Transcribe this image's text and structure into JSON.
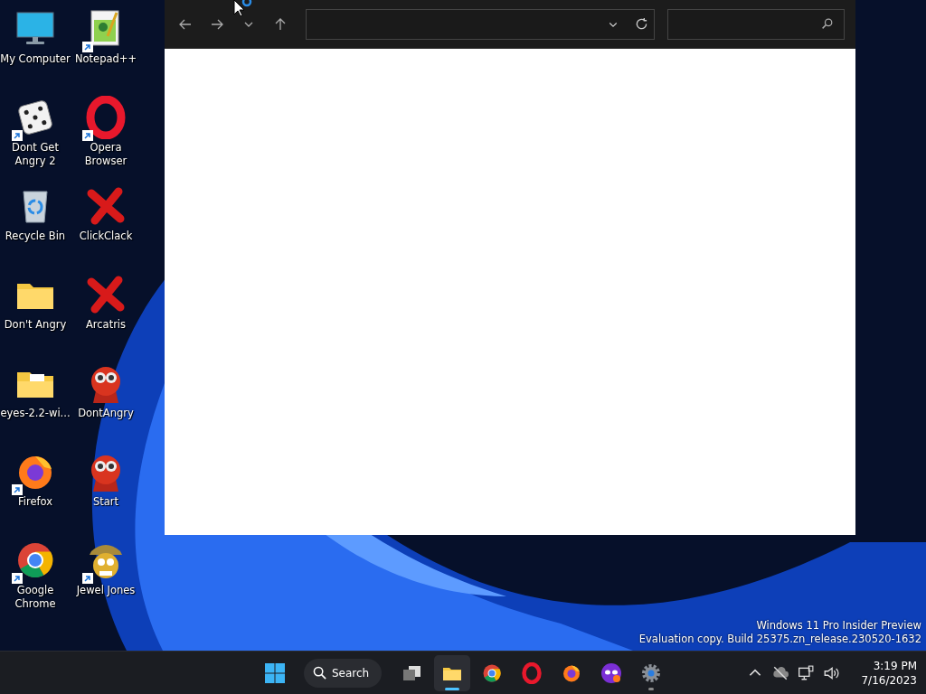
{
  "desktop_icons": [
    {
      "label": "My Computer",
      "kind": "monitor",
      "shortcut": false
    },
    {
      "label": "Notepad++",
      "kind": "notepad",
      "shortcut": true
    },
    {
      "label": "Dont Get Angry 2",
      "kind": "dice",
      "shortcut": true
    },
    {
      "label": "Opera Browser",
      "kind": "opera",
      "shortcut": true
    },
    {
      "label": "Recycle Bin",
      "kind": "recycle",
      "shortcut": false
    },
    {
      "label": "ClickClack",
      "kind": "cross",
      "shortcut": false
    },
    {
      "label": "Don't Angry",
      "kind": "folder",
      "shortcut": false
    },
    {
      "label": "Arcatris",
      "kind": "cross",
      "shortcut": false
    },
    {
      "label": "eyes-2.2-wi...",
      "kind": "folder-files",
      "shortcut": false
    },
    {
      "label": "DontAngry",
      "kind": "eyes",
      "shortcut": false
    },
    {
      "label": "Firefox",
      "kind": "firefox",
      "shortcut": true
    },
    {
      "label": "Start",
      "kind": "eyes",
      "shortcut": false
    },
    {
      "label": "Google Chrome",
      "kind": "chrome",
      "shortcut": true
    },
    {
      "label": "Jewel Jones",
      "kind": "cartoon",
      "shortcut": true
    }
  ],
  "build_info": {
    "line_1": "Windows 11 Pro Insider Preview",
    "line_2": "Evaluation copy. Build 25375.zn_release.230520-1632"
  },
  "taskbar": {
    "search_label": "Search",
    "apps": [
      {
        "kind": "task-view",
        "running": false,
        "selected": false
      },
      {
        "kind": "folder",
        "running": true,
        "selected": true
      },
      {
        "kind": "chrome",
        "running": false,
        "selected": false
      },
      {
        "kind": "opera",
        "running": false,
        "selected": false
      },
      {
        "kind": "firefox",
        "running": false,
        "selected": false
      },
      {
        "kind": "mask",
        "running": false,
        "selected": false
      },
      {
        "kind": "gear",
        "running": true,
        "selected": false
      }
    ],
    "time": "3:19 PM",
    "date": "7/16/2023"
  }
}
